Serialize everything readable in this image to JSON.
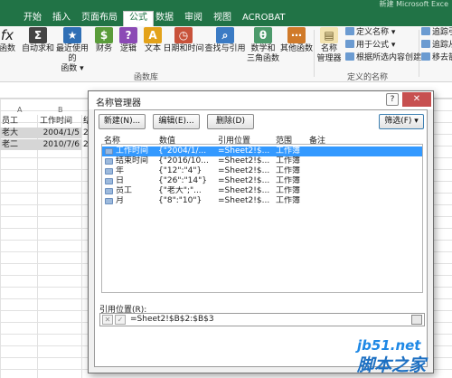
{
  "app_title": "新建 Microsoft Exce",
  "tabs": [
    {
      "label": "开始"
    },
    {
      "label": "插入"
    },
    {
      "label": "页面布局"
    },
    {
      "label": "公式"
    },
    {
      "label": "数据"
    },
    {
      "label": "审阅"
    },
    {
      "label": "视图"
    },
    {
      "label": "ACROBAT"
    }
  ],
  "ribbon": {
    "insert_fn": "fx",
    "left_cut": "函数",
    "buttons": [
      {
        "line1": "自动求和",
        "line2": "",
        "glyph": "Σ",
        "color": "#444444"
      },
      {
        "line1": "最近使用的",
        "line2": "函数 ▾",
        "glyph": "★",
        "color": "#2f6fb5"
      },
      {
        "line1": "财务",
        "line2": "",
        "glyph": "$",
        "color": "#5a9c3a"
      },
      {
        "line1": "逻辑",
        "line2": "",
        "glyph": "?",
        "color": "#8b4ab5"
      },
      {
        "line1": "文本",
        "line2": "",
        "glyph": "A",
        "color": "#e3a21a"
      },
      {
        "line1": "日期和时间",
        "line2": "",
        "glyph": "◷",
        "color": "#c8523a"
      },
      {
        "line1": "查找与引用",
        "line2": "",
        "glyph": "⌕",
        "color": "#3b7bc4"
      },
      {
        "line1": "数学和",
        "line2": "三角函数",
        "glyph": "θ",
        "color": "#4c9a6b"
      },
      {
        "line1": "其他函数",
        "line2": "",
        "glyph": "⋯",
        "color": "#d07a2a"
      }
    ],
    "group_library": "函数库",
    "name_mgr_line1": "名称",
    "name_mgr_line2": "管理器",
    "define_name": "定义名称 ▾",
    "use_in_formula": "用于公式 ▾",
    "create_from_sel": "根据所选内容创建",
    "group_names": "定义的名称",
    "trace1": "追踪引",
    "trace2": "追踪从",
    "trace3": "移去箭"
  },
  "sheet": {
    "col_a": "A",
    "col_b": "B",
    "rows": [
      [
        "员工",
        "工作时间",
        "结"
      ],
      [
        "老大",
        "2004/1/5",
        "2"
      ],
      [
        "老二",
        "2010/7/6",
        "2"
      ]
    ]
  },
  "dialog": {
    "title": "名称管理器",
    "help": "?",
    "close": "✕",
    "new_btn": "新建(N)...",
    "edit_btn": "编辑(E)...",
    "delete_btn": "删除(D)",
    "filter_btn": "筛选(F) ▾",
    "columns": [
      "名称",
      "数值",
      "引用位置",
      "范围",
      "备注"
    ],
    "names": [
      {
        "name": "工作时间",
        "value": "{\"2004/1/...",
        "ref": "=Sheet2!$...",
        "scope": "工作簿",
        "note": ""
      },
      {
        "name": "结束时间",
        "value": "{\"2016/10...",
        "ref": "=Sheet2!$...",
        "scope": "工作簿",
        "note": ""
      },
      {
        "name": "年",
        "value": "{\"12\":\"4\"}",
        "ref": "=Sheet2!$...",
        "scope": "工作簿",
        "note": ""
      },
      {
        "name": "日",
        "value": "{\"26\":\"14\"}",
        "ref": "=Sheet2!$...",
        "scope": "工作簿",
        "note": ""
      },
      {
        "name": "员工",
        "value": "{\"老大\";\"...",
        "ref": "=Sheet2!$...",
        "scope": "工作簿",
        "note": ""
      },
      {
        "name": "月",
        "value": "{\"8\":\"10\"}",
        "ref": "=Sheet2!$...",
        "scope": "工作簿",
        "note": ""
      }
    ],
    "selected_index": 0,
    "refers_to_label": "引用位置(R):",
    "refers_to_value": "=Sheet2!$B$2:$B$3",
    "cancel_glyph": "✕",
    "ok_glyph": "✓"
  },
  "watermark": {
    "line1": "jb51.net",
    "line2": "脚本之家"
  }
}
